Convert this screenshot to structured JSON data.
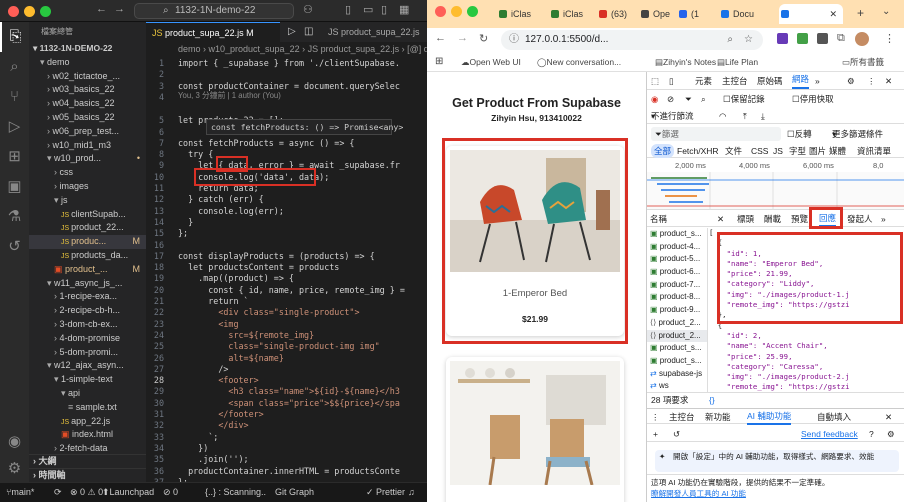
{
  "vscode": {
    "search_text": "1132-1N-demo-22",
    "explorer_title": "檔案總管",
    "project": "1132-1N-DEMO-22",
    "tree": [
      {
        "label": "demo",
        "depth": 1,
        "arrow": "▾",
        "kind": "folder",
        "mark": ""
      },
      {
        "label": "w02_tictactoe_...",
        "depth": 2,
        "arrow": "›",
        "kind": "folder",
        "mark": ""
      },
      {
        "label": "w03_basics_22",
        "depth": 2,
        "arrow": "›",
        "kind": "folder",
        "mark": ""
      },
      {
        "label": "w04_basics_22",
        "depth": 2,
        "arrow": "›",
        "kind": "folder",
        "mark": ""
      },
      {
        "label": "w05_basics_22",
        "depth": 2,
        "arrow": "›",
        "kind": "folder",
        "mark": ""
      },
      {
        "label": "w06_prep_test...",
        "depth": 2,
        "arrow": "›",
        "kind": "folder",
        "mark": ""
      },
      {
        "label": "w10_mid1_m3",
        "depth": 2,
        "arrow": "›",
        "kind": "folder",
        "mark": ""
      },
      {
        "label": "w10_prod...",
        "depth": 2,
        "arrow": "▾",
        "kind": "folder",
        "mark": "•"
      },
      {
        "label": "css",
        "depth": 3,
        "arrow": "›",
        "kind": "folder",
        "mark": ""
      },
      {
        "label": "images",
        "depth": 3,
        "arrow": "›",
        "kind": "folder",
        "mark": ""
      },
      {
        "label": "js",
        "depth": 3,
        "arrow": "▾",
        "kind": "folder",
        "mark": ""
      },
      {
        "label": "clientSupab...",
        "depth": 4,
        "arrow": "",
        "kind": "js",
        "mark": ""
      },
      {
        "label": "product_22...",
        "depth": 4,
        "arrow": "",
        "kind": "js",
        "mark": ""
      },
      {
        "label": "produc...",
        "depth": 4,
        "arrow": "",
        "kind": "js",
        "mark": "M",
        "sel": true
      },
      {
        "label": "products_da...",
        "depth": 4,
        "arrow": "",
        "kind": "js",
        "mark": ""
      },
      {
        "label": "product_...",
        "depth": 3,
        "arrow": "",
        "kind": "html",
        "mark": "M"
      },
      {
        "label": "w11_async_js_...",
        "depth": 2,
        "arrow": "▾",
        "kind": "folder",
        "mark": ""
      },
      {
        "label": "1-recipe-exa...",
        "depth": 3,
        "arrow": "›",
        "kind": "folder",
        "mark": ""
      },
      {
        "label": "2-recipe-cb-h...",
        "depth": 3,
        "arrow": "›",
        "kind": "folder",
        "mark": ""
      },
      {
        "label": "3-dom-cb-ex...",
        "depth": 3,
        "arrow": "›",
        "kind": "folder",
        "mark": ""
      },
      {
        "label": "4-dom-promise",
        "depth": 3,
        "arrow": "›",
        "kind": "folder",
        "mark": ""
      },
      {
        "label": "5-dom-promi...",
        "depth": 3,
        "arrow": "›",
        "kind": "folder",
        "mark": ""
      },
      {
        "label": "w12_ajax_asyn...",
        "depth": 2,
        "arrow": "▾",
        "kind": "folder",
        "mark": ""
      },
      {
        "label": "1-simple-text",
        "depth": 3,
        "arrow": "▾",
        "kind": "folder",
        "mark": ""
      },
      {
        "label": "api",
        "depth": 4,
        "arrow": "▾",
        "kind": "folder",
        "mark": ""
      },
      {
        "label": "sample.txt",
        "depth": 5,
        "arrow": "",
        "kind": "txt",
        "mark": ""
      },
      {
        "label": "app_22.js",
        "depth": 4,
        "arrow": "",
        "kind": "js",
        "mark": ""
      },
      {
        "label": "index.html",
        "depth": 4,
        "arrow": "",
        "kind": "html",
        "mark": ""
      },
      {
        "label": "2-fetch-data",
        "depth": 3,
        "arrow": "›",
        "kind": "folder",
        "mark": ""
      }
    ],
    "outline_label": "大綱",
    "timeline_label": "時間軸",
    "tab1": "product_supa_22.js M",
    "tab2": "JS product_supa_22.js",
    "breadcrumb": "demo › w10_product_supa_22 › JS product_supa_22.js › [@] displ",
    "blame": "You, 3 分鐘前 | 1 author (You)",
    "tooltip": "const fetchProducts: () => Promise<any>",
    "code_lines": [
      {
        "n": "1",
        "t": "import { _supabase } from './clientSupabase."
      },
      {
        "n": "2",
        "t": ""
      },
      {
        "n": "3",
        "t": "const productContainer = document.querySelec"
      },
      {
        "n": "4",
        "t": ""
      },
      {
        "n": "5",
        "t": "let products_22 = [];"
      },
      {
        "n": "6",
        "t": ""
      },
      {
        "n": "7",
        "t": "const fetchProducts = async () => {"
      },
      {
        "n": "8",
        "t": "  try {"
      },
      {
        "n": "9",
        "t": "    let { data, error } = await _supabase.fr"
      },
      {
        "n": "10",
        "t": "    console.log('data', data);"
      },
      {
        "n": "11",
        "t": "    return data;"
      },
      {
        "n": "12",
        "t": "  } catch (err) {"
      },
      {
        "n": "13",
        "t": "    console.log(err);"
      },
      {
        "n": "14",
        "t": "  }"
      },
      {
        "n": "15",
        "t": "};"
      },
      {
        "n": "16",
        "t": ""
      },
      {
        "n": "17",
        "t": "const displayProducts = (products) => {"
      },
      {
        "n": "18",
        "t": "  let productsContent = products"
      },
      {
        "n": "19",
        "t": "    .map((product) => {"
      },
      {
        "n": "20",
        "t": "      const { id, name, price, remote_img } ="
      },
      {
        "n": "21",
        "t": "      return `"
      },
      {
        "n": "22",
        "t": "        <div class=\"single-product\">"
      },
      {
        "n": "23",
        "t": "        <img"
      },
      {
        "n": "24",
        "t": "          src=${remote_img}"
      },
      {
        "n": "25",
        "t": "          class=\"single-product-img img\""
      },
      {
        "n": "26",
        "t": "          alt=${name}"
      },
      {
        "n": "27",
        "t": "        />"
      },
      {
        "n": "28",
        "t": "        <footer>"
      },
      {
        "n": "29",
        "t": "          <h3 class=\"name\">${id}-${name}</h3"
      },
      {
        "n": "30",
        "t": "          <span class=\"price\">$${price}</spa"
      },
      {
        "n": "31",
        "t": "        </footer>"
      },
      {
        "n": "32",
        "t": "        </div>"
      },
      {
        "n": "33",
        "t": "      `;"
      },
      {
        "n": "34",
        "t": "    })"
      },
      {
        "n": "35",
        "t": "    .join('');"
      },
      {
        "n": "36",
        "t": "  productContainer.innerHTML = productsConte"
      },
      {
        "n": "37",
        "t": "};"
      }
    ],
    "status": {
      "branch": "main*",
      "sync": "⟳",
      "errors": "⊗ 0 ⚠ 0",
      "launch": "Launchpad",
      "warnings": "⊘ 0",
      "scanning": "{..} : Scanning..",
      "graph": "Git Graph",
      "prettier": "✓ Prettier"
    }
  },
  "chrome": {
    "tabs": [
      "iClas",
      "iClas",
      "(63)",
      "Ope",
      "(1",
      "Docu",
      ""
    ],
    "url": "127.0.0.1:5500/d...",
    "bookmarks": [
      "Open Web UI",
      "New conversation...",
      "Zihyin's Notes",
      "Life Plan",
      "所有書籤"
    ]
  },
  "page": {
    "title": "Get Product From Supabase",
    "author": "Zihyin Hsu, 913410022",
    "products": [
      {
        "name": "1-Emperor Bed",
        "price": "$21.99"
      }
    ]
  },
  "devtools": {
    "tabs": [
      "元素",
      "主控台",
      "原始碼",
      "網路"
    ],
    "preserve_log": "保留記錄",
    "disable_cache": "停用快取",
    "throttle": "不進行節流",
    "filter_placeholder": "篩選",
    "invert": "反轉",
    "more_filters": "更多篩選條件",
    "types": [
      "全部",
      "Fetch/XHR",
      "文件",
      "CSS",
      "JS",
      "字型",
      "圖片",
      "媒體",
      "資訊清單"
    ],
    "timeline_ticks": [
      "2,000 ms",
      "4,000 ms",
      "6,000 ms",
      "8,0"
    ],
    "panel_tabs": [
      "名稱",
      "標頭",
      "酬載",
      "預覽",
      "回應",
      "發起人"
    ],
    "requests": [
      "product_s...",
      "product-4...",
      "product-5...",
      "product-6...",
      "product-7...",
      "product-8...",
      "product-9...",
      "product_2...",
      "product_2...",
      "product_s...",
      "product_s...",
      "supabase-js",
      "ws"
    ],
    "requests_count": "28 項要求",
    "json_lines": [
      {
        "t": "[",
        "c": ""
      },
      {
        "t": "  {",
        "c": ""
      },
      {
        "t": "    \"id\": 1,",
        "c": "k"
      },
      {
        "t": "    \"name\": \"Emperor Bed\",",
        "c": "k"
      },
      {
        "t": "    \"price\": 21.99,",
        "c": "k"
      },
      {
        "t": "    \"category\": \"Liddy\",",
        "c": "k"
      },
      {
        "t": "    \"img\": \"./images/product-1.j",
        "c": "k"
      },
      {
        "t": "    \"remote_img\": \"https://gstzi",
        "c": "k"
      },
      {
        "t": "  },",
        "c": ""
      },
      {
        "t": "  {",
        "c": ""
      },
      {
        "t": "    \"id\": 2,",
        "c": "k"
      },
      {
        "t": "    \"name\": \"Accent Chair\",",
        "c": "k"
      },
      {
        "t": "    \"price\": 25.99,",
        "c": "k"
      },
      {
        "t": "    \"category\": \"Caressa\",",
        "c": "k"
      },
      {
        "t": "    \"img\": \"./images/product-2.j",
        "c": "k"
      },
      {
        "t": "    \"remote_img\": \"https://gstzi",
        "c": "k"
      },
      {
        "t": "  },",
        "c": ""
      }
    ],
    "drawer_tabs": [
      "主控台",
      "新功能",
      "AI 輔助功能",
      "自動填入"
    ],
    "feedback": "Send feedback",
    "ai_notice": "開啟「設定」中的 AI 輔助功能，取得樣式、網路要求、效能",
    "ai_notice2": "這項 AI 功能仍在實驗階段，提供的結果不一定準確。",
    "ai_link": "瞭解開發人員工具的 AI 功能"
  }
}
